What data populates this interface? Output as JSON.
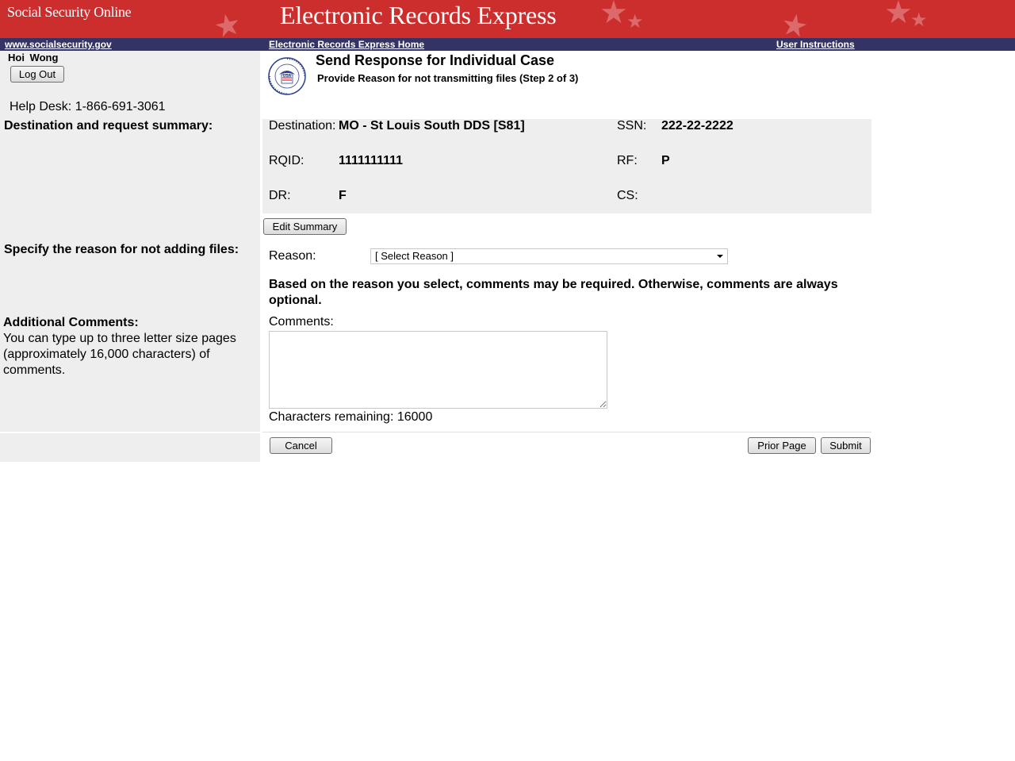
{
  "header": {
    "brand": "Social Security Online",
    "title": "Electronic Records Express"
  },
  "nav": {
    "left_link": "www.socialsecurity.gov",
    "home_link": "Electronic Records Express Home",
    "instructions_link": "User Instructions"
  },
  "user": {
    "name": "Hoi  Wong",
    "logout_label": "Log Out",
    "help_desk": "Help Desk: 1-866-691-3061"
  },
  "page": {
    "title": "Send Response for Individual Case",
    "subtitle": "Provide Reason for not transmitting files (Step 2 of 3)",
    "logo_text": "USA"
  },
  "sections": {
    "destination_summary": "Destination and request summary:",
    "reason": "Specify the reason for not adding files:",
    "comments_heading": "Additional Comments:",
    "comments_help": "You can type up to three letter size pages (approximately 16,000 characters) of comments."
  },
  "summary": {
    "destination_label": "Destination:",
    "destination_value": "MO - St Louis South DDS [S81]",
    "ssn_label": "SSN:",
    "ssn_value": "222-22-2222",
    "rqid_label": "RQID:",
    "rqid_value": "1111111111",
    "rf_label": "RF:",
    "rf_value": "P",
    "dr_label": "DR:",
    "dr_value": "F",
    "cs_label": "CS:",
    "cs_value": ""
  },
  "form": {
    "edit_summary_label": "Edit Summary",
    "reason_label": "Reason:",
    "reason_selected": "[ Select Reason ]",
    "reason_note": "Based on the reason you select, comments may be required. Otherwise, comments are always optional.",
    "comments_label": "Comments:",
    "comments_value": "",
    "chars_remaining": "Characters remaining: 16000"
  },
  "actions": {
    "cancel": "Cancel",
    "prior_page": "Prior Page",
    "submit": "Submit"
  },
  "colors": {
    "banner": "#cc2e2e",
    "navbar": "#333366",
    "panel": "#eeeeee"
  }
}
